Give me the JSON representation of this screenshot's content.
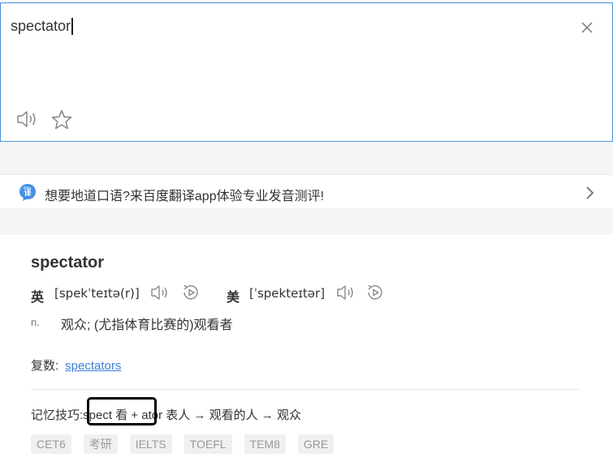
{
  "input": {
    "value": "spectator",
    "clear_icon": "close-icon",
    "speak_icon": "speaker-icon",
    "favorite_icon": "star-icon"
  },
  "promo": {
    "text": "想要地道口语?来百度翻译app体验专业发音测评!",
    "icon": "app-logo-icon",
    "arrow_icon": "chevron-right-icon"
  },
  "result": {
    "word": "spectator",
    "pronunciations": [
      {
        "label": "英",
        "ipa": "[spekˈteɪtə(r)]"
      },
      {
        "label": "美",
        "ipa": "[ˈspekteɪtər]"
      }
    ],
    "definitions": [
      {
        "pos": "n.",
        "meaning": "观众;  (尤指体育比赛的)观看者"
      }
    ],
    "plural_label": "复数:",
    "plural_value": "spectators",
    "mnemonic_label": "记忆技巧:",
    "mnemonic_text": "spect 看 + ator 表人 → 观看的人 → 观众",
    "tags": [
      "CET6",
      "考研",
      "IELTS",
      "TOEFL",
      "TEM8",
      "GRE"
    ]
  },
  "colors": {
    "accent": "#4a90d9",
    "link": "#3b7fd8",
    "background_gray": "#f5f5f5",
    "tag_bg": "#f0f0f0"
  }
}
